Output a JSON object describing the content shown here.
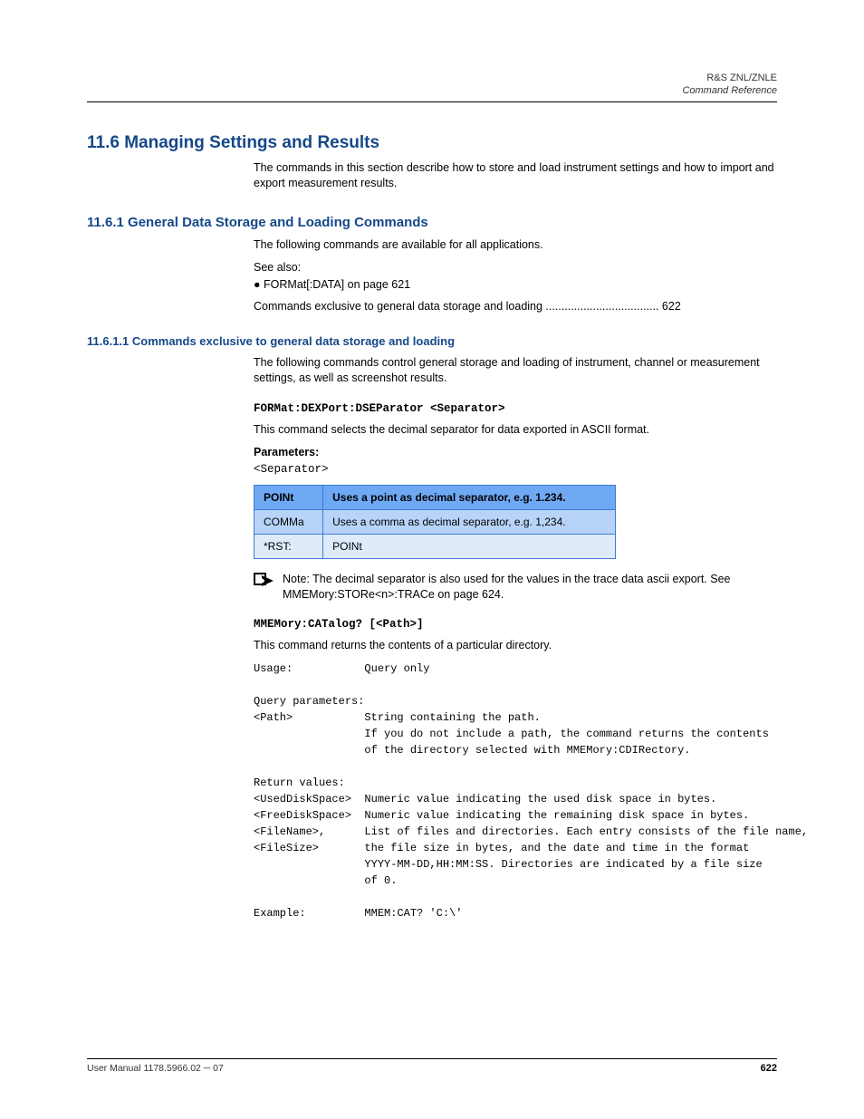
{
  "header": {
    "path": "R&S ZNL/ZNLE",
    "title": "Command Reference"
  },
  "sections": {
    "h2": "11.6  Managing Settings and Results",
    "intro": "The commands in this section describe how to store and load instrument settings and how to import and export measurement results.",
    "h3": "11.6.1  General Data Storage and Loading Commands",
    "desc1": "The following commands are available for all applications.",
    "desc2": "See also:",
    "bullet": "● FORMat[:DATA] on page 621",
    "subhead": "Commands exclusive to general data storage and loading .................................... 622",
    "h4": "11.6.1.1 Commands exclusive to general data storage and loading",
    "desc3": "The following commands control general storage and loading of instrument, channel or measurement settings, as well as screenshot results.",
    "h5": "FORMat:DEXPort:DSEParator <Separator>",
    "desc4": "This command selects the decimal separator for data exported in ASCII format.",
    "params_label": "Parameters:",
    "param_name": "<Separator>",
    "table": {
      "caption_num": "",
      "caption_text": "",
      "headers": [
        "POINt",
        "Uses a point as decimal separator, e.g. 1.234."
      ],
      "rows": [
        [
          "COMMa",
          "Uses a comma as decimal separator, e.g. 1,234."
        ],
        [
          "*RST:",
          "POINt"
        ]
      ]
    },
    "note": "Note: The decimal separator is also used for the values in the trace data ascii export. See MMEMory:STORe<n>:TRACe on page 624.",
    "code1": "MMEMory:CATalog? [<Path>]",
    "code1_desc": "This command returns the contents of a particular directory.",
    "code2": [
      "Usage:           Query only",
      "",
      "Query parameters:",
      "<Path>           String containing the path.",
      "                 If you do not include a path, the command returns the contents",
      "                 of the directory selected with MMEMory:CDIRectory.",
      "",
      "Return values:",
      "<UsedDiskSpace>  Numeric value indicating the used disk space in bytes.",
      "<FreeDiskSpace>  Numeric value indicating the remaining disk space in bytes.",
      "<FileName>,      List of files and directories. Each entry consists of the file name,",
      "<FileSize>       the file size in bytes, and the date and time in the format",
      "                 YYYY-MM-DD,HH:MM:SS. Directories are indicated by a file size",
      "                 of 0.",
      "",
      "Example:         MMEM:CAT? 'C:\\'"
    ]
  },
  "footer": {
    "left": "User Manual 1178.5966.02 ─ 07",
    "right": "622"
  }
}
